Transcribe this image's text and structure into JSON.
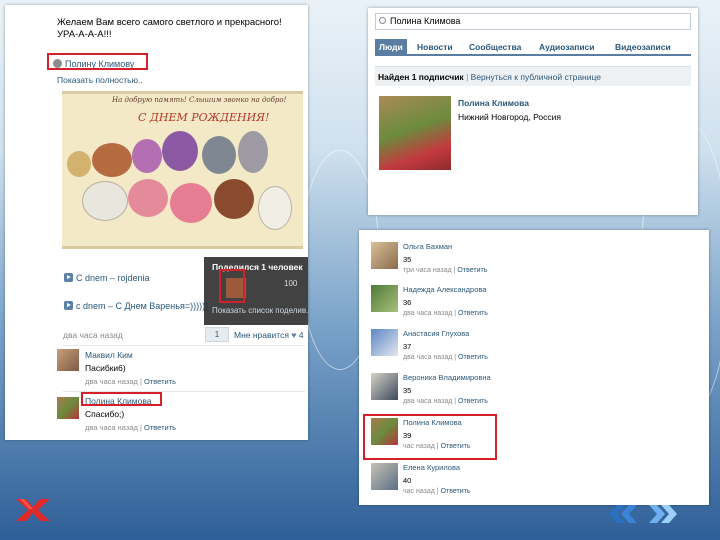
{
  "left": {
    "wish_text": "Желаем Вам всего самого светлого и прекрасного! УРА-А-А-А!!!",
    "poster_name": "Полину Климову",
    "show_full": "Показать полностью..",
    "card_title_line1": "На добрую память! Слышим звонко на добро!",
    "card_title_line2": "С ДНЕМ РОЖДЕНИЯ!",
    "attachments": [
      "С dnem – rojdenia",
      "с dnem – С Днем Варенья=))))))"
    ],
    "share_popup": {
      "title": "Поделился 1 человек",
      "count": "100",
      "button": "Показать список поделив..."
    },
    "post_time": "два часа назад",
    "share_count": "1",
    "likes_label": "Мне нравится",
    "likes_count": "4",
    "comments": [
      {
        "name": "Маквил Ким",
        "text": "Пасибки6)",
        "time": "два часа назад",
        "reply": "Ответить"
      },
      {
        "name": "Полина Климова",
        "text": "Спасибо;)",
        "time": "два часа назад",
        "reply": "Ответить"
      }
    ]
  },
  "right_top": {
    "search_value": "Полина Климова",
    "tabs": [
      "Люди",
      "Новости",
      "Сообщества",
      "Аудиозаписи",
      "Видеозаписи"
    ],
    "found_bold": "Найден 1 подписчик",
    "found_link": "Вернуться к публичной странице",
    "result_name": "Полина Климова",
    "result_city": "Нижний Новгород, Россия"
  },
  "right_bottom": {
    "rows": [
      {
        "name": "Ольга Бахман",
        "age": "35",
        "time": "три часа назад",
        "reply": "Ответить"
      },
      {
        "name": "Надежда Александрова",
        "age": "36",
        "time": "два часа назад",
        "reply": "Ответить"
      },
      {
        "name": "Анастасия Глухова",
        "age": "37",
        "time": "два часа назад",
        "reply": "Ответить"
      },
      {
        "name": "Вероника Владимировна",
        "age": "35",
        "time": "два часа назад",
        "reply": "Ответить"
      },
      {
        "name": "Полина Климова",
        "age": "39",
        "time": "час назад",
        "reply": "Ответить"
      },
      {
        "name": "Елена Курилова",
        "age": "40",
        "time": "час назад",
        "reply": "Ответить"
      }
    ]
  },
  "colors": {
    "highlight": "#d4202b",
    "link": "#2b587a",
    "tab_active": "#597da3"
  },
  "icons": [
    "play-icon",
    "search-icon",
    "heart-icon",
    "megaphone-icon",
    "logo-x-icon",
    "arrows-icon"
  ]
}
